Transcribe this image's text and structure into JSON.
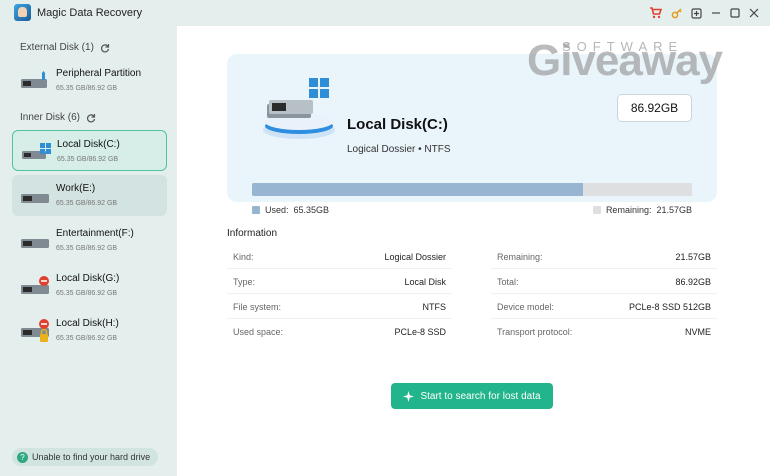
{
  "app": {
    "title": "Magic Data Recovery",
    "accent_color": "#22b48a",
    "titlebar_icons": [
      "cart-icon",
      "key-icon",
      "feedback-icon",
      "minimize-icon",
      "maximize-icon",
      "close-icon"
    ]
  },
  "sidebar": {
    "external_label": "External Disk (1)",
    "inner_label": "Inner Disk (6)",
    "external_disks": [
      {
        "name": "Peripheral Partition",
        "size": "65.35 GB/86.92 GB",
        "icon": "usb-drive-icon"
      }
    ],
    "inner_disks": [
      {
        "name": "Local Disk(C:)",
        "size": "65.35 GB/86.92 GB",
        "icon": "windows-drive-icon",
        "state": "selected"
      },
      {
        "name": "Work(E:)",
        "size": "65.35 GB/86.92 GB",
        "icon": "drive-icon",
        "state": "hover"
      },
      {
        "name": "Entertainment(F:)",
        "size": "65.35 GB/86.92 GB",
        "icon": "drive-icon"
      },
      {
        "name": "Local Disk(G:)",
        "size": "65.35 GB/86.92 GB",
        "icon": "drive-error-icon"
      },
      {
        "name": "Local Disk(H:)",
        "size": "65.35 GB/86.92 GB",
        "icon": "drive-locked-icon"
      }
    ],
    "help_text": "Unable to find your hard drive"
  },
  "disk_card": {
    "name": "Local Disk(C:)",
    "type_line": "Logical Dossier • NTFS",
    "capacity": "86.92GB",
    "used_label": "Used:",
    "used_value": "65.35GB",
    "remaining_label": "Remaining:",
    "remaining_value": "21.57GB",
    "used_fraction": 0.752,
    "used_color": "#97b5d1",
    "remaining_color": "#dddfe1"
  },
  "watermark": {
    "main": "Giveaway",
    "sub": "SOFTWARE"
  },
  "information": {
    "heading": "Information",
    "rows": [
      {
        "left_key": "Kind:",
        "left_value": "Logical Dossier",
        "right_key": "Remaining:",
        "right_value": "21.57GB"
      },
      {
        "left_key": "Type:",
        "left_value": "Local Disk",
        "right_key": "Total:",
        "right_value": "86.92GB"
      },
      {
        "left_key": "File system:",
        "left_value": "NTFS",
        "right_key": "Device model:",
        "right_value": "PCLe-8 SSD 512GB"
      },
      {
        "left_key": "Used space:",
        "left_value": "PCLe-8 SSD",
        "right_key": "Transport protocol:",
        "right_value": "NVME"
      }
    ]
  },
  "scan_button": {
    "label": "Start to search for lost data"
  }
}
